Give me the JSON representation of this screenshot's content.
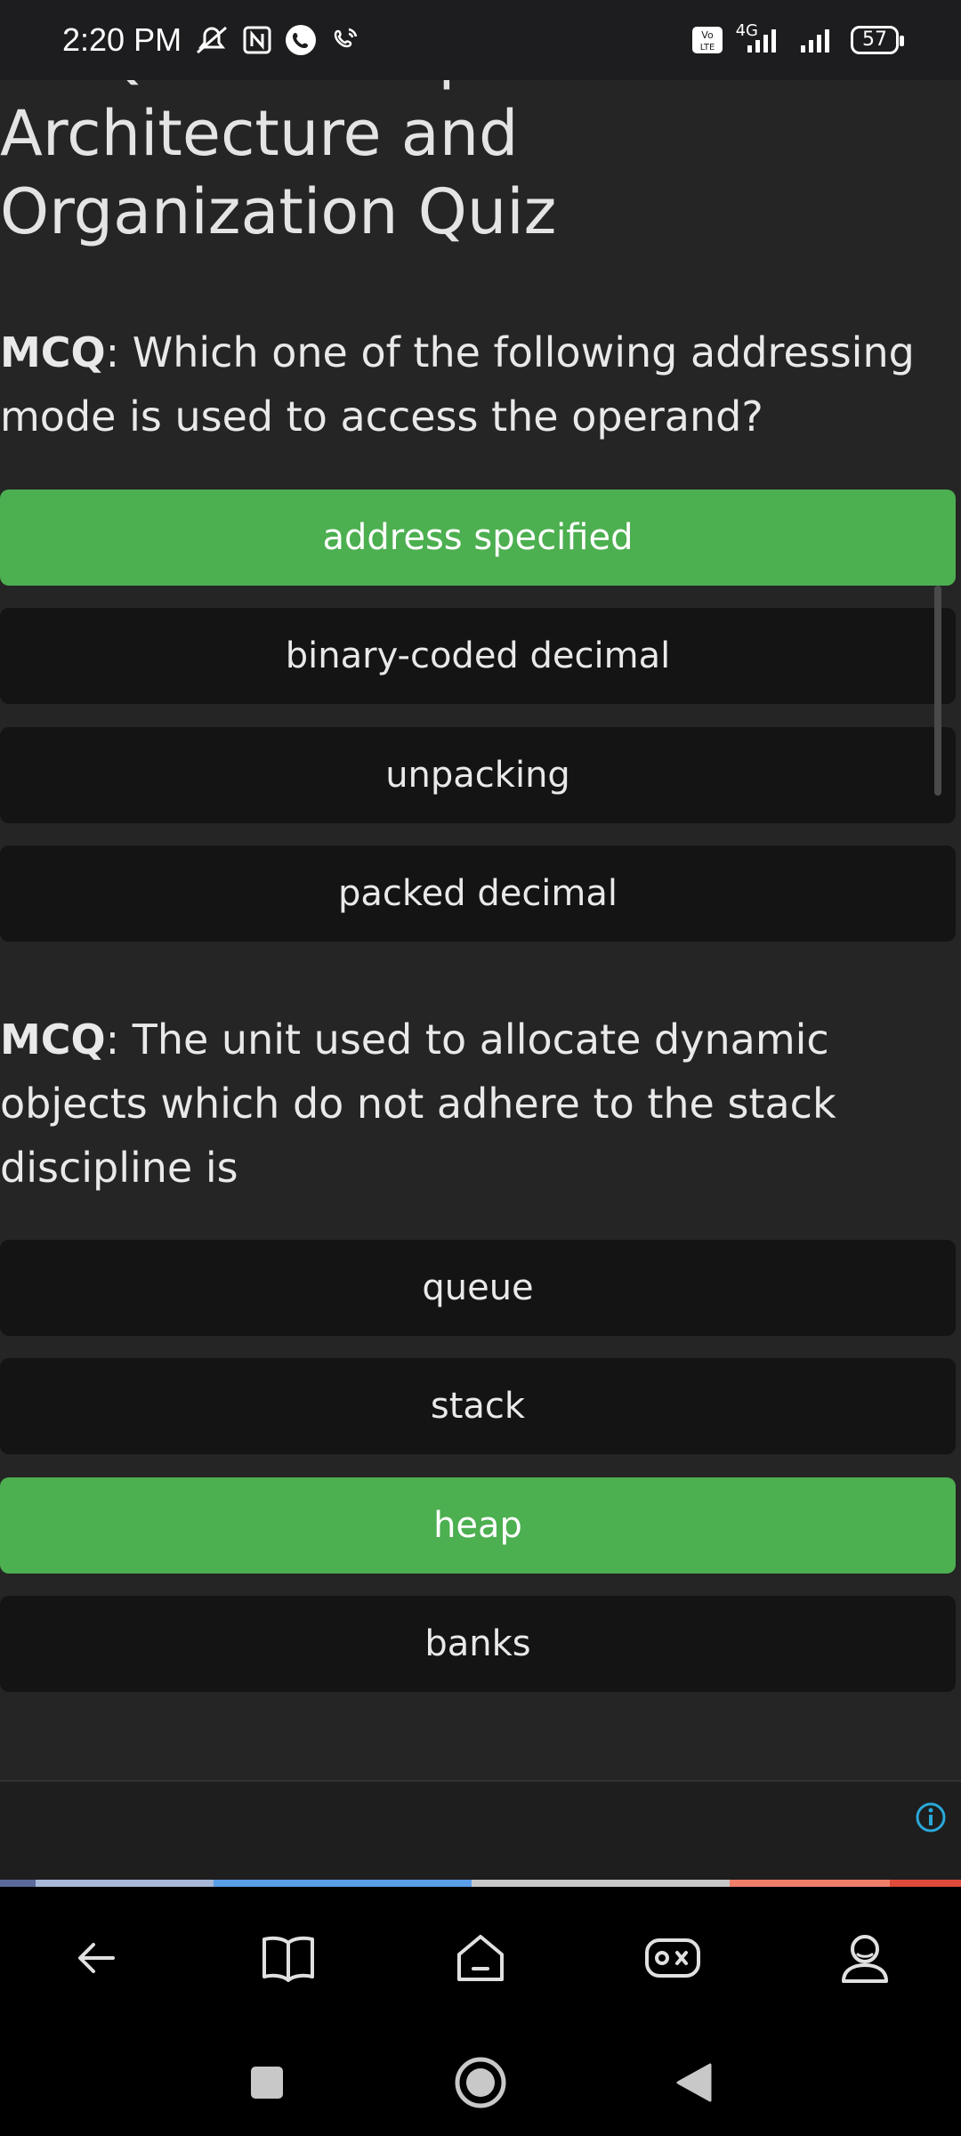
{
  "status_bar": {
    "time": "2:20 PM",
    "network": "4G",
    "battery": "57"
  },
  "quiz": {
    "title": "MCQs on Computer Architecture and Organization Quiz"
  },
  "questions": [
    {
      "prefix": "MCQ",
      "text": ": Which one of the following addressing mode is used to access the operand?",
      "options": [
        {
          "label": "address specified",
          "correct": true
        },
        {
          "label": "binary-coded decimal",
          "correct": false
        },
        {
          "label": "unpacking",
          "correct": false
        },
        {
          "label": "packed decimal",
          "correct": false
        }
      ]
    },
    {
      "prefix": "MCQ",
      "text": ": The unit used to allocate dynamic objects which do not adhere to the stack discipline is",
      "options": [
        {
          "label": "queue",
          "correct": false
        },
        {
          "label": "stack",
          "correct": false
        },
        {
          "label": "heap",
          "correct": true
        },
        {
          "label": "banks",
          "correct": false
        }
      ]
    }
  ],
  "colors": {
    "correct": "#4caf50",
    "option_bg": "#141414",
    "page_bg": "#252525"
  },
  "bottom_nav": [
    "back-icon",
    "book-icon",
    "home-icon",
    "game-icon",
    "profile-icon"
  ],
  "system_nav": [
    "recents-icon",
    "home-circle-icon",
    "back-triangle-icon"
  ]
}
